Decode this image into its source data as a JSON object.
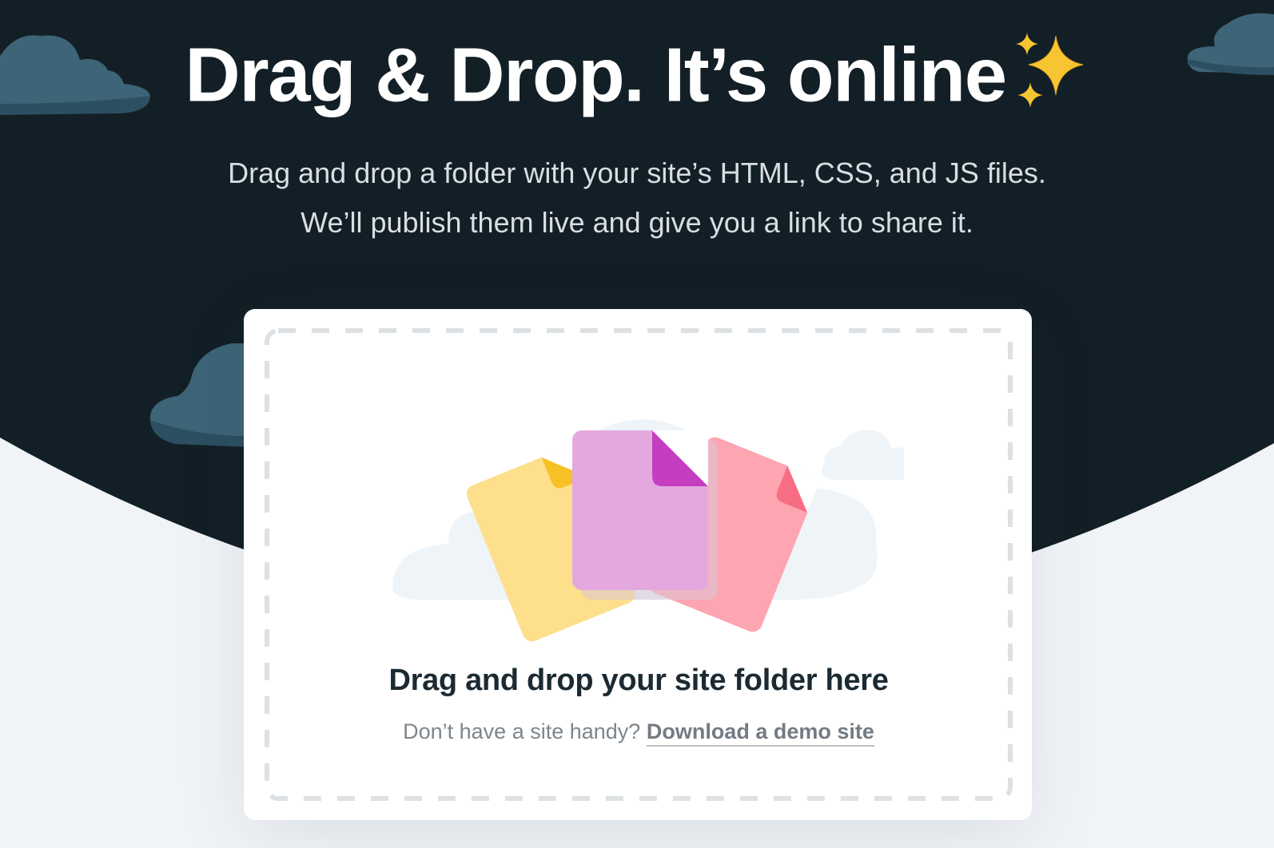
{
  "hero": {
    "title": "Drag & Drop. It’s online",
    "subtitle_line1": "Drag and drop a folder with your site’s HTML, CSS, and JS files.",
    "subtitle_line2": "We’ll publish them live and give you a link to share it."
  },
  "dropzone": {
    "heading": "Drag and drop your site folder here",
    "help_text": "Don’t have a site handy?",
    "demo_link_label": "Download a demo site"
  },
  "icons": [
    "sparkles-icon",
    "cloud-icon",
    "folder-files-icon"
  ],
  "colors": {
    "hero_background": "#131f26",
    "page_background": "#f1f4f7",
    "cloud": "#3d6477",
    "file_yellow": "#fddf8c",
    "file_purple": "#e3a9df",
    "file_pink": "#fda5b1",
    "heading_text": "#1b2a33"
  }
}
